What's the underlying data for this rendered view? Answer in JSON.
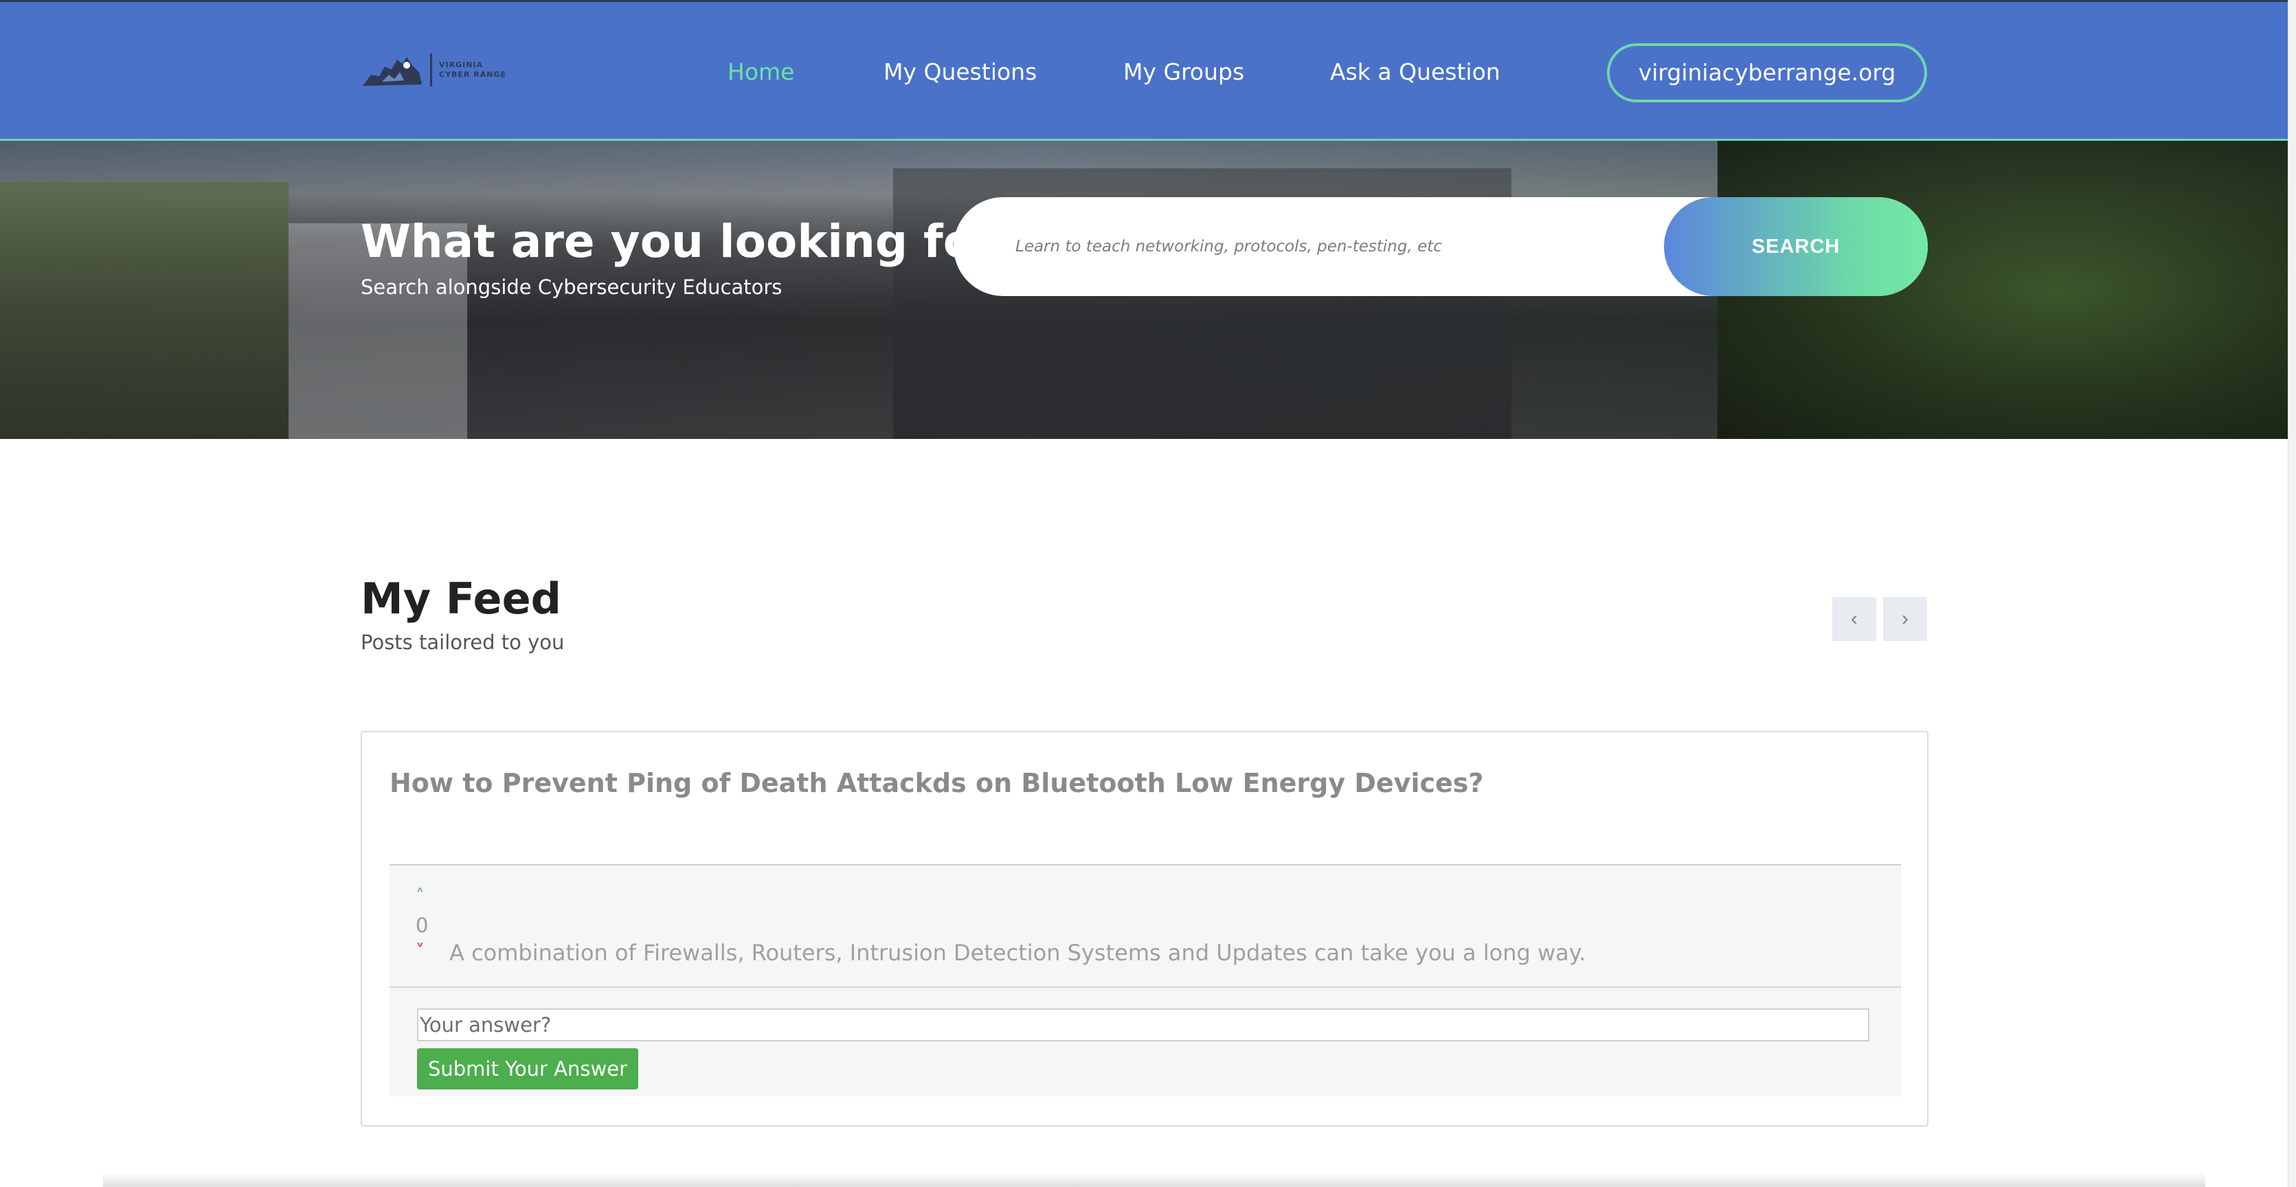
{
  "header": {
    "logo": {
      "line1": "VIRGINIA",
      "line2": "CYBER RANGE"
    },
    "nav": [
      {
        "label": "Home",
        "active": true
      },
      {
        "label": "My Questions",
        "active": false
      },
      {
        "label": "My Groups",
        "active": false
      },
      {
        "label": "Ask a Question",
        "active": false
      }
    ],
    "site_link": "virginiacyberrange.org"
  },
  "hero": {
    "title": "What are you looking for?",
    "subtitle": "Search alongside Cybersecurity Educators",
    "search_placeholder": "Learn to teach networking, protocols, pen-testing, etc",
    "search_button": "SEARCH"
  },
  "feed": {
    "title": "My Feed",
    "subtitle": "Posts tailored to you",
    "prev_icon": "chevron-left-icon",
    "next_icon": "chevron-right-icon",
    "posts": [
      {
        "question": "How to Prevent Ping of Death Attackds on Bluetooth Low Energy Devices?",
        "answer": {
          "votes": "0",
          "text": "A combination of Firewalls, Routers, Intrusion Detection Systems and Updates can take you a long way."
        },
        "answer_placeholder": "Your answer?",
        "submit_label": "Submit Your Answer"
      }
    ]
  },
  "colors": {
    "navbar": "#4a72c9",
    "accent_green": "#6fe0a8",
    "submit_green": "#4cae4c",
    "downvote_red": "#d9534f"
  }
}
